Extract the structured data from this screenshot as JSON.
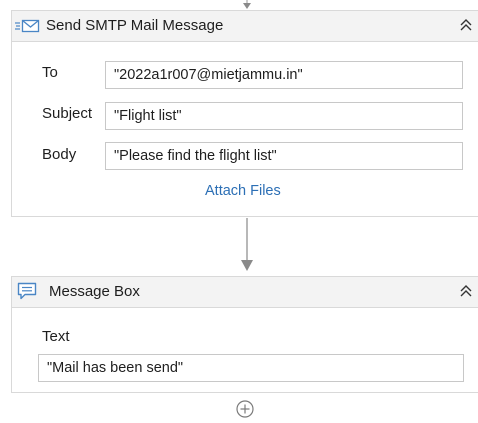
{
  "smtp_activity": {
    "title": "Send SMTP Mail Message",
    "to_label": "To",
    "to_value": "\"2022a1r007@mietjammu.in\"",
    "subject_label": "Subject",
    "subject_value": "\"Flight list\"",
    "body_label": "Body",
    "body_value": "\"Please find the flight list\"",
    "attach_files_label": "Attach Files"
  },
  "message_box_activity": {
    "title": "Message Box",
    "text_label": "Text",
    "text_value": "\"Mail has been send\""
  },
  "icons": {
    "mail": "mail-envelope-icon",
    "message": "speech-bubble-icon",
    "collapse": "double-chevron-up-icon",
    "flow_arrow": "arrow-down-icon",
    "add": "plus-circle-icon"
  },
  "colors": {
    "link": "#2c6fb5",
    "icon_blue": "#4a86c5",
    "header_bg": "#f3f3f3",
    "border": "#d9d9d9"
  }
}
